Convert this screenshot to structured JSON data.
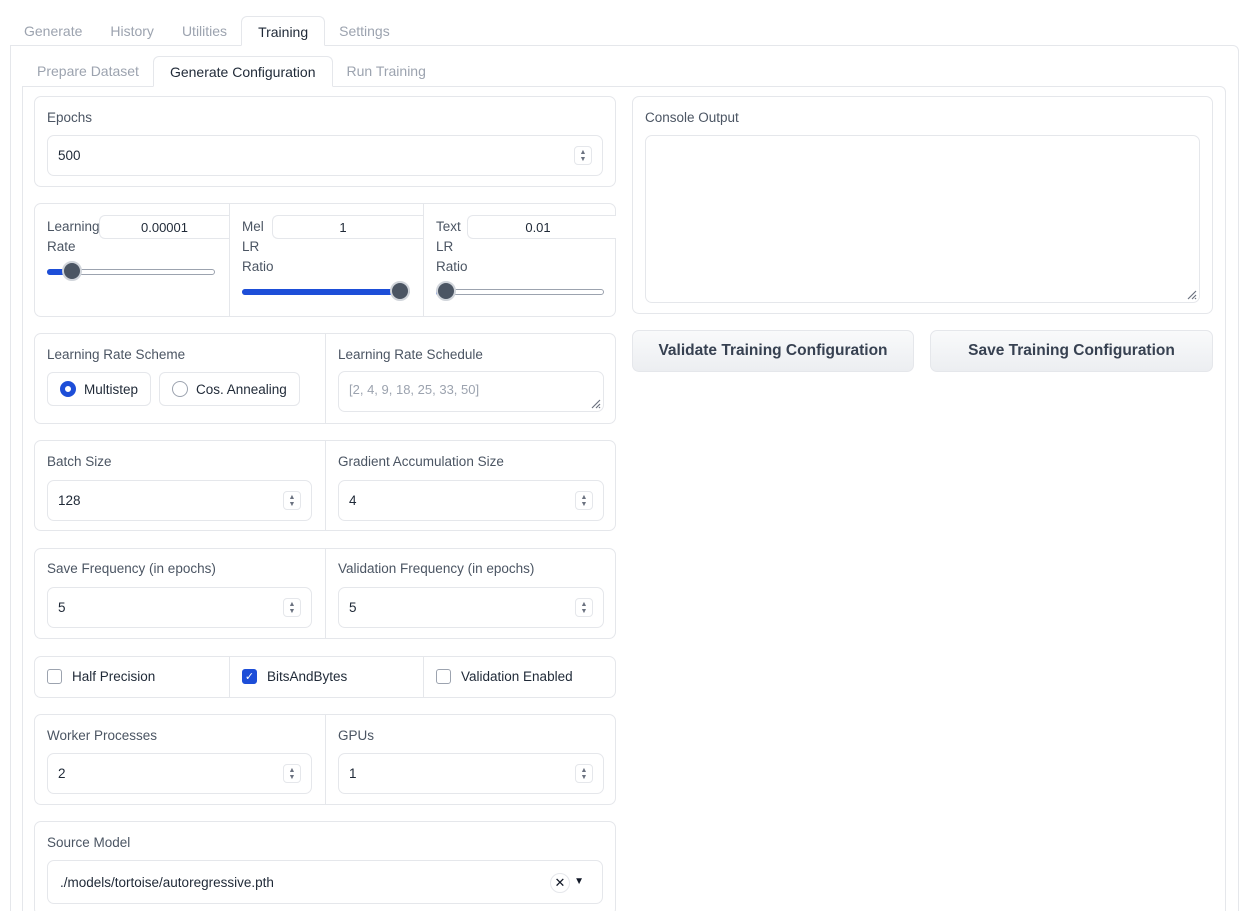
{
  "top_tabs": [
    "Generate",
    "History",
    "Utilities",
    "Training",
    "Settings"
  ],
  "top_active": "Training",
  "sub_tabs": [
    "Prepare Dataset",
    "Generate Configuration",
    "Run Training"
  ],
  "sub_active": "Generate Configuration",
  "epochs": {
    "label": "Epochs",
    "value": "500"
  },
  "learning_rate": {
    "label": "Learning Rate",
    "value": "0.00001",
    "fraction": 0.0
  },
  "mel_lr_ratio": {
    "label": "Mel LR Ratio",
    "value": "1",
    "fraction": 1.0
  },
  "text_lr_ratio": {
    "label": "Text LR Ratio",
    "value": "0.01",
    "fraction": 0.0
  },
  "lr_scheme": {
    "label": "Learning Rate Scheme",
    "options": [
      "Multistep",
      "Cos. Annealing"
    ],
    "selected": "Multistep"
  },
  "lr_schedule": {
    "label": "Learning Rate Schedule",
    "placeholder": "[2, 4, 9, 18, 25, 33, 50]"
  },
  "batch_size": {
    "label": "Batch Size",
    "value": "128"
  },
  "grad_accum": {
    "label": "Gradient Accumulation Size",
    "value": "4"
  },
  "save_freq": {
    "label": "Save Frequency (in epochs)",
    "value": "5"
  },
  "val_freq": {
    "label": "Validation Frequency (in epochs)",
    "value": "5"
  },
  "half_precision": {
    "label": "Half Precision",
    "checked": false
  },
  "bitsandbytes": {
    "label": "BitsAndBytes",
    "checked": true
  },
  "validation_enabled": {
    "label": "Validation Enabled",
    "checked": false
  },
  "workers": {
    "label": "Worker Processes",
    "value": "2"
  },
  "gpus": {
    "label": "GPUs",
    "value": "1"
  },
  "source_model": {
    "label": "Source Model",
    "value": "./models/tortoise/autoregressive.pth"
  },
  "console": {
    "label": "Console Output",
    "value": ""
  },
  "buttons": {
    "validate": "Validate Training Configuration",
    "save": "Save Training Configuration"
  },
  "colors": {
    "accent": "#1d4ed8",
    "border": "#e5e7eb"
  }
}
